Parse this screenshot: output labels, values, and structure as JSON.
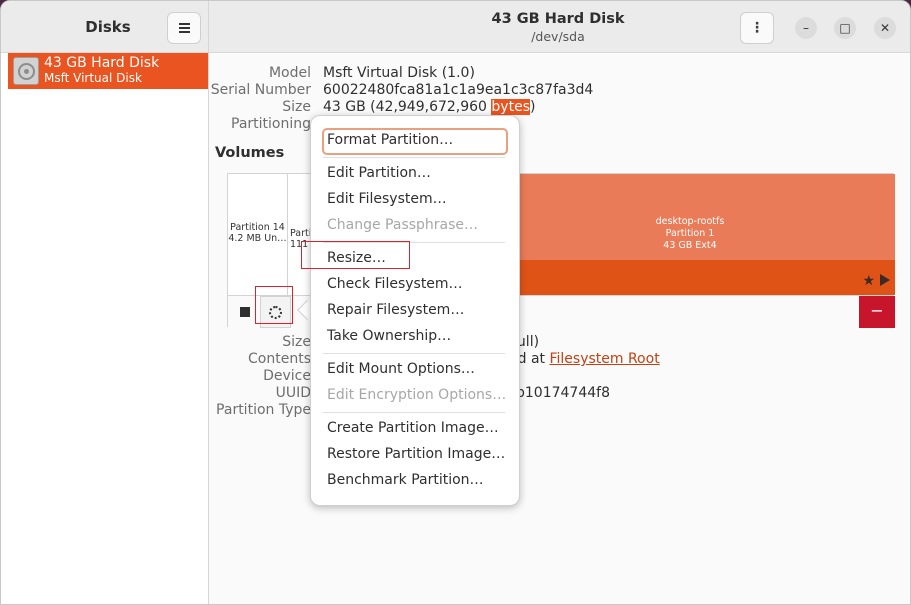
{
  "sidebar": {
    "title": "Disks",
    "disk": {
      "name": "43 GB Hard Disk",
      "model": "Msft Virtual Disk"
    }
  },
  "header": {
    "title": "43 GB Hard Disk",
    "subtitle": "/dev/sda",
    "kebab": "⋮",
    "minimize": "–",
    "maximize": "□",
    "close": "✕"
  },
  "drive_info": {
    "model_label": "Model",
    "model": "Msft Virtual Disk (1.0)",
    "serial_label": "Serial Number",
    "serial": "60022480fca81a1c1a9ea1c3c87fa3d4",
    "size_label": "Size",
    "size_prefix": "43 GB (42,949,672,960 ",
    "size_highlight": "bytes",
    "size_suffix": ")",
    "partitioning_label": "Partitioning"
  },
  "volumes": {
    "title": "Volumes",
    "partition14": {
      "line1": "Partition 14",
      "line2": "4.2 MB Un…"
    },
    "partition15": {
      "line1": "Parti",
      "line2": "111"
    },
    "partition1": {
      "name": "desktop-rootfs",
      "number": "Partition 1",
      "desc": "43 GB Ext4"
    },
    "minus": "−"
  },
  "vol_info": {
    "size_label": "Size",
    "contents_label": "Contents",
    "device_label": "Device",
    "uuid_label": "UUID",
    "partition_type_label": "Partition Type",
    "size_tail": "full)",
    "contents_tail_prefix": "ed at ",
    "contents_link": "Filesystem Root",
    "uuid_tail": "b10174744f8"
  },
  "menu": {
    "items": [
      {
        "label": "Format Partition…",
        "enabled": true
      },
      {
        "label": "Edit Partition…",
        "enabled": true
      },
      {
        "label": "Edit Filesystem…",
        "enabled": true
      },
      {
        "label": "Change Passphrase…",
        "enabled": false
      },
      {
        "label": "Resize…",
        "enabled": true
      },
      {
        "label": "Check Filesystem…",
        "enabled": true
      },
      {
        "label": "Repair Filesystem…",
        "enabled": true
      },
      {
        "label": "Take Ownership…",
        "enabled": true
      },
      {
        "label": "Edit Mount Options…",
        "enabled": true
      },
      {
        "label": "Edit Encryption Options…",
        "enabled": false
      },
      {
        "label": "Create Partition Image…",
        "enabled": true
      },
      {
        "label": "Restore Partition Image…",
        "enabled": true
      },
      {
        "label": "Benchmark Partition…",
        "enabled": true
      }
    ]
  },
  "colors": {
    "accent": "#e95420",
    "partition": "#e97b58",
    "danger": "#c7162b",
    "annotation": "#d9232e"
  }
}
